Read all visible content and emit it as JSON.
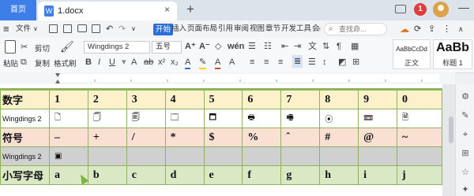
{
  "tabs": {
    "home": "首页",
    "doc_icon": "W",
    "doc_name": "1.docx",
    "close": "×",
    "new": "+"
  },
  "window": {
    "badge": "1",
    "minimize": "—"
  },
  "menu": {
    "hamburger": "≡",
    "file": "文件",
    "file_arrow": "∨",
    "items": [
      "开始",
      "插入",
      "页面布局",
      "引用",
      "审阅",
      "视图",
      "章节",
      "开发工具",
      "会"
    ],
    "more": "‹",
    "search_placeholder": "查找命...",
    "right_icons": [
      "☁",
      "⟳",
      "⇪",
      "⋮",
      "∧"
    ]
  },
  "ribbon": {
    "paste": "粘贴",
    "cut": "剪切",
    "copy": "复制",
    "format_painter": "格式刷",
    "font_name": "Wingdings 2",
    "font_size": "五号",
    "style_normal_preview": "AaBbCcDd",
    "style_normal": "正文",
    "style_h1_preview": "AaBb",
    "style_h1": "标题 1"
  },
  "table": {
    "rows": [
      {
        "key": "r-num",
        "label": "数字",
        "label_class": "lbl",
        "cell_class": "",
        "cells": [
          "1",
          "2",
          "3",
          "4",
          "5",
          "6",
          "7",
          "8",
          "9",
          "0"
        ]
      },
      {
        "key": "r-wing1",
        "label": "Wingdings 2",
        "label_class": "lbl-sm",
        "cell_class": "sym",
        "cells": [
          "🗋",
          "🗍",
          "🗐",
          "🗔",
          "🗖",
          "🖶",
          "🖷",
          "⦿",
          "📼",
          "🗎"
        ]
      },
      {
        "key": "r-sym",
        "label": "符号",
        "label_class": "lbl",
        "cell_class": "",
        "cells": [
          "–",
          "+",
          "/",
          "*",
          "$",
          "%",
          "ˆ",
          "#",
          "@",
          "~"
        ]
      },
      {
        "key": "r-wing2",
        "label": "Wingdings 2",
        "label_class": "lbl-sm",
        "cell_class": "sym",
        "cells": [
          "▣",
          "",
          "",
          "",
          "",
          "",
          "",
          "",
          "",
          ""
        ]
      },
      {
        "key": "r-low",
        "label": "小写字母",
        "label_class": "lbl",
        "cell_class": "",
        "cells": [
          "a",
          "b",
          "c",
          "d",
          "e",
          "f",
          "g",
          "h",
          "i",
          "j"
        ]
      }
    ]
  },
  "right_panel": [
    "⚙",
    "✎",
    "⌖",
    "⊞",
    "☆",
    "✦"
  ]
}
